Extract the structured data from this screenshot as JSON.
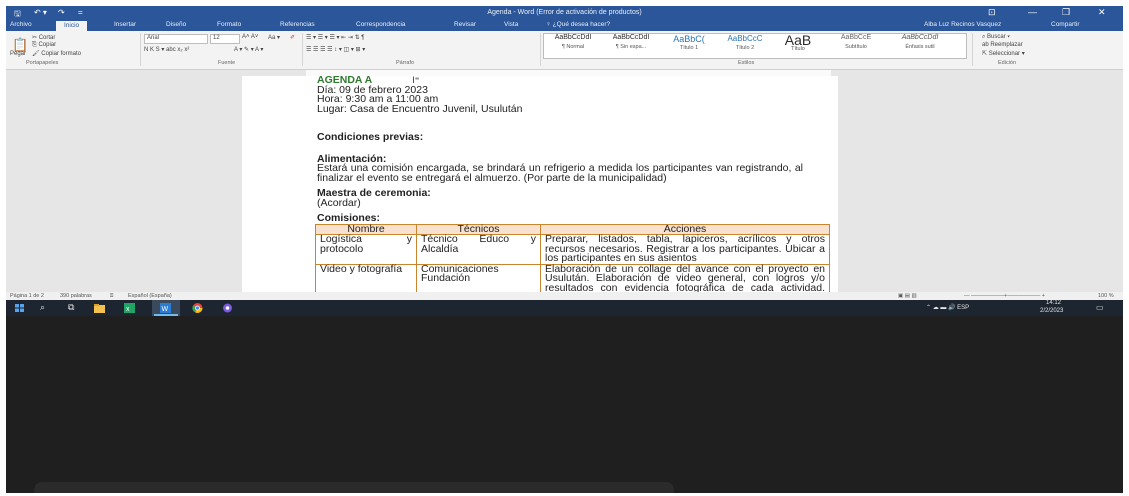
{
  "window": {
    "title": "Agenda - Word (Error de activación de productos)",
    "user": "Alba Luz Recinos Vasquez",
    "share": "Compartir",
    "qa_save": "🖫",
    "qa_undo": "↶ ▾",
    "qa_redo": "↷",
    "qa_more": "=",
    "ribbon_options": "⊡",
    "minimize": "—",
    "restore": "❐",
    "close": "✕"
  },
  "tabs": [
    "Archivo",
    "Inicio",
    "Insertar",
    "Diseño",
    "Formato",
    "Referencias",
    "Correspondencia",
    "Revisar",
    "Vista"
  ],
  "tell_me": "♀ ¿Qué desea hacer?",
  "ribbon": {
    "clipboard": {
      "paste": "Pegar",
      "cut": "✂ Cortar",
      "copy": "⎘ Copiar",
      "format_painter": "🖌 Copiar formato",
      "group": "Portapapeles"
    },
    "font": {
      "name": "Arial",
      "size": "12",
      "grow_shrink": "A˄ A˅",
      "case": "Aa ▾",
      "clear": "✐",
      "format_row": "N K S ▾ abc x₂ x²",
      "color_row": "A ▾ ✎ ▾ A ▾",
      "group": "Fuente"
    },
    "paragraph": {
      "list_row": "☰ ▾ ☰ ▾ ☰ ▾  ⇤ ⇥  ⇅  ¶",
      "align_row": "☰ ☰ ☰ ☰  ↕ ▾  ◫ ▾ ⊞ ▾",
      "group": "Párrafo"
    },
    "styles": [
      {
        "sample": "AaBbCcDdI",
        "name": "¶ Normal"
      },
      {
        "sample": "AaBbCcDdI",
        "name": "¶ Sin espa..."
      },
      {
        "sample": "AaBbC(",
        "name": "Título 1"
      },
      {
        "sample": "AaBbCcC",
        "name": "Título 2"
      },
      {
        "sample": "AaB",
        "name": "Título"
      },
      {
        "sample": "AaBbCcE",
        "name": "Subtítulo"
      },
      {
        "sample": "AaBbCcDdI",
        "name": "Énfasis sutil"
      }
    ],
    "styles_group": "Estilos",
    "editing": {
      "find": "⌕ Buscar ▾",
      "replace": "ab Reemplazar",
      "select": "⇱ Seleccionar ▾",
      "group": "Edición"
    }
  },
  "document": {
    "title": "AGENDA A",
    "cursor": "I⁼",
    "date": "Día: 09 de febrero 2023",
    "time": "Hora: 9:30 am a 11:00 am",
    "place": "Lugar: Casa de Encuentro Juvenil, Usulután",
    "prior_conditions": "Condiciones previas:",
    "food_heading": "Alimentación:",
    "food_text": "Estará una comisión encargada, se brindará un refrigerio a medida los participantes van registrando, al finalizar el evento se entregará el almuerzo. (Por parte de la municipalidad)",
    "mc_heading": "Maestra de ceremonia:",
    "mc_text": "(Acordar)",
    "commissions_heading": "Comisiones:",
    "table": {
      "headers": [
        "Nombre",
        "Técnicos",
        "Acciones"
      ],
      "rows": [
        {
          "name": "Logística y protocolo",
          "tech": "Técnico Educo y Alcaldía",
          "actions": "Preparar, listados, tabla, lapiceros, acrílicos y otros recursos necesarios. Registrar a los participantes. Ubicar a los participantes en sus asientos"
        },
        {
          "name": "Video y fotografía",
          "tech": "Comunicaciones Fundación",
          "actions": "Elaboración de un collage del avance con el proyecto en Usulután. Elaboración de video general, con logros y/o resultados con evidencia fotográfica de cada actividad. Capturar fotografía diferentes momentos el día"
        }
      ]
    }
  },
  "status": {
    "page": "Página 1 de 2",
    "words": "390 palabras",
    "proofing": "⌸",
    "language": "Español (España)",
    "zoom": "100 %",
    "view_icons": "▣ ▤ ▥",
    "zoom_controls": "—  ——————+——————  +"
  },
  "taskbar": {
    "search_glyph": "⌕",
    "taskview_glyph": "⧉",
    "tray": "⌃  ☁  ▬  🔊  ESP",
    "time": "14:12",
    "date": "2/2/2023",
    "notification": "▭",
    "icons": [
      {
        "name": "start-icon",
        "color": "#5aa3e6"
      },
      {
        "name": "search-icon",
        "color": "#cccccc"
      },
      {
        "name": "task-view-icon",
        "color": "#cccccc"
      },
      {
        "name": "file-explorer-icon",
        "color": "#f2c14e"
      },
      {
        "name": "excel-icon",
        "color": "#21a366"
      },
      {
        "name": "word-icon",
        "color": "#2b7cd3"
      },
      {
        "name": "chrome-icon",
        "color": "#e8453c"
      },
      {
        "name": "app-icon",
        "color": "#7a5ad8"
      }
    ]
  },
  "colors": {
    "word_blue": "#2b579a",
    "agenda_green": "#2f7a2f",
    "table_border": "#c9852e",
    "table_header_bg": "#f8e1cf"
  }
}
